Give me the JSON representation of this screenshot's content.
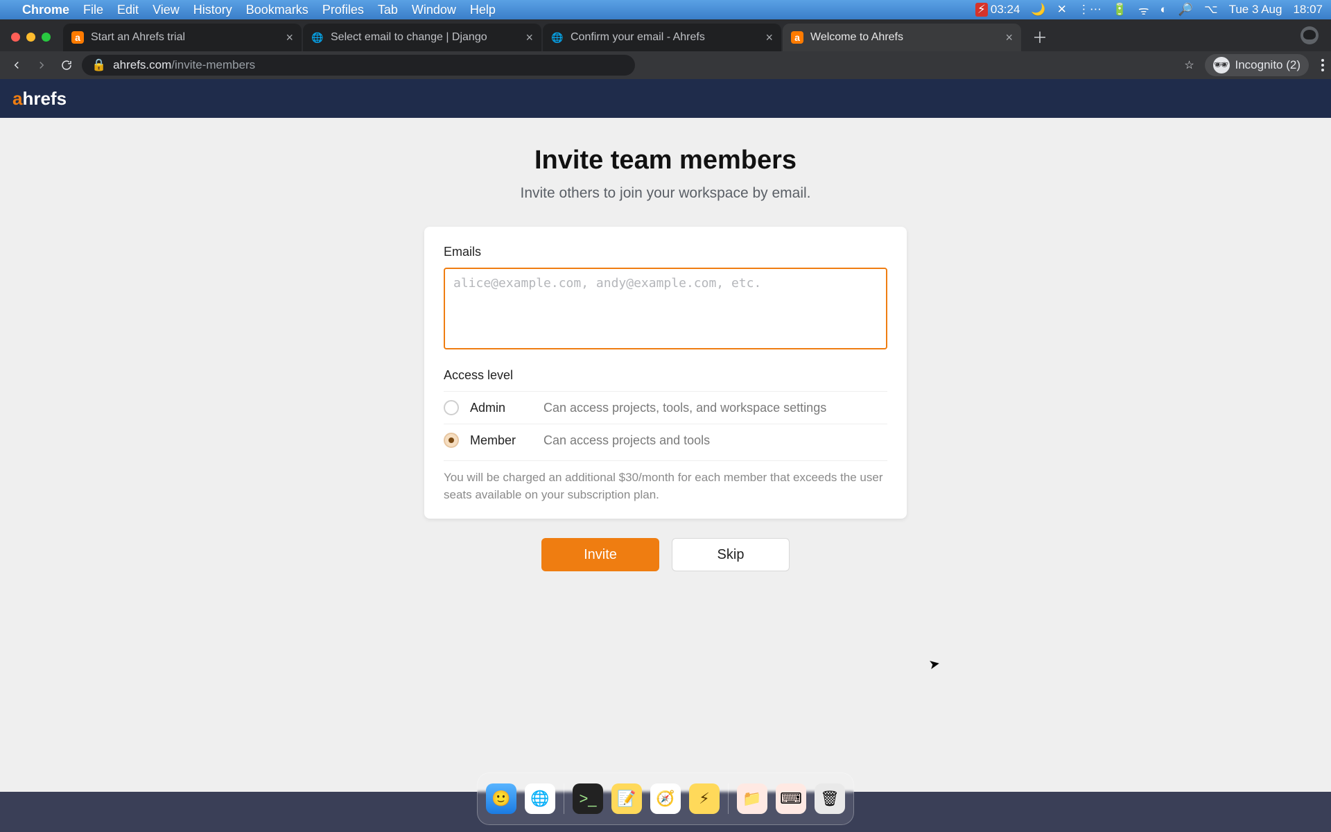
{
  "os": {
    "app_name": "Chrome",
    "menus": [
      "File",
      "Edit",
      "View",
      "History",
      "Bookmarks",
      "Profiles",
      "Tab",
      "Window",
      "Help"
    ],
    "right": {
      "timer": "03:24",
      "date": "Tue 3 Aug",
      "time": "18:07"
    }
  },
  "chrome": {
    "tabs": [
      {
        "title": "Start an Ahrefs trial",
        "active": false,
        "icon": "orange-a"
      },
      {
        "title": "Select email to change | Django",
        "active": false,
        "icon": "globe"
      },
      {
        "title": "Confirm your email - Ahrefs",
        "active": false,
        "icon": "globe"
      },
      {
        "title": "Welcome to Ahrefs",
        "active": true,
        "icon": "orange-a"
      }
    ],
    "url_host": "ahrefs.com",
    "url_path": "/invite-members",
    "incognito_label": "Incognito (2)"
  },
  "brand": {
    "a": "a",
    "rest": "hrefs"
  },
  "page": {
    "title": "Invite team members",
    "subtitle": "Invite others to join your workspace by email.",
    "emails_label": "Emails",
    "emails_placeholder": "alice@example.com, andy@example.com, etc.",
    "access_label": "Access level",
    "options": [
      {
        "name": "Admin",
        "desc": "Can access projects, tools, and workspace settings",
        "selected": false
      },
      {
        "name": "Member",
        "desc": "Can access projects and tools",
        "selected": true
      }
    ],
    "fineprint": "You will be charged an additional $30/month for each member that exceeds the user seats available on your subscription plan.",
    "invite": "Invite",
    "skip": "Skip"
  }
}
